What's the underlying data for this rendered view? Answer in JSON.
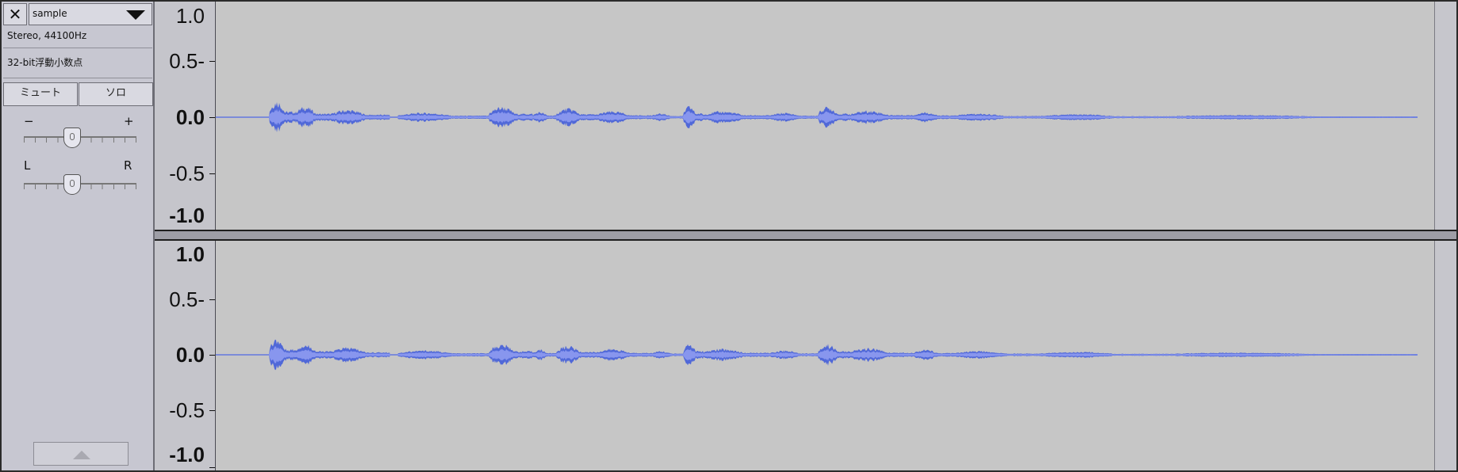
{
  "track": {
    "close_label": "✕",
    "name": "sample",
    "info_rate": "Stereo, 44100Hz",
    "info_format": "32-bit浮動小数点",
    "mute_label": "ミュート",
    "solo_label": "ソロ",
    "gain": {
      "minus": "−",
      "plus": "+",
      "level": 0.42
    },
    "pan": {
      "left": "L",
      "right": "R",
      "level": 0.42
    }
  },
  "ruler": {
    "labels": [
      "1.0",
      "0.5-",
      "0.0",
      "-0.5",
      "-1.0"
    ]
  },
  "colors": {
    "waveform": "#5068d8",
    "waveform_rms": "#8896ee",
    "background": "#c6c6c6"
  },
  "icons": {
    "close": "close-icon",
    "dropdown": "chevron-down-icon",
    "collapse": "chevron-up-icon"
  }
}
